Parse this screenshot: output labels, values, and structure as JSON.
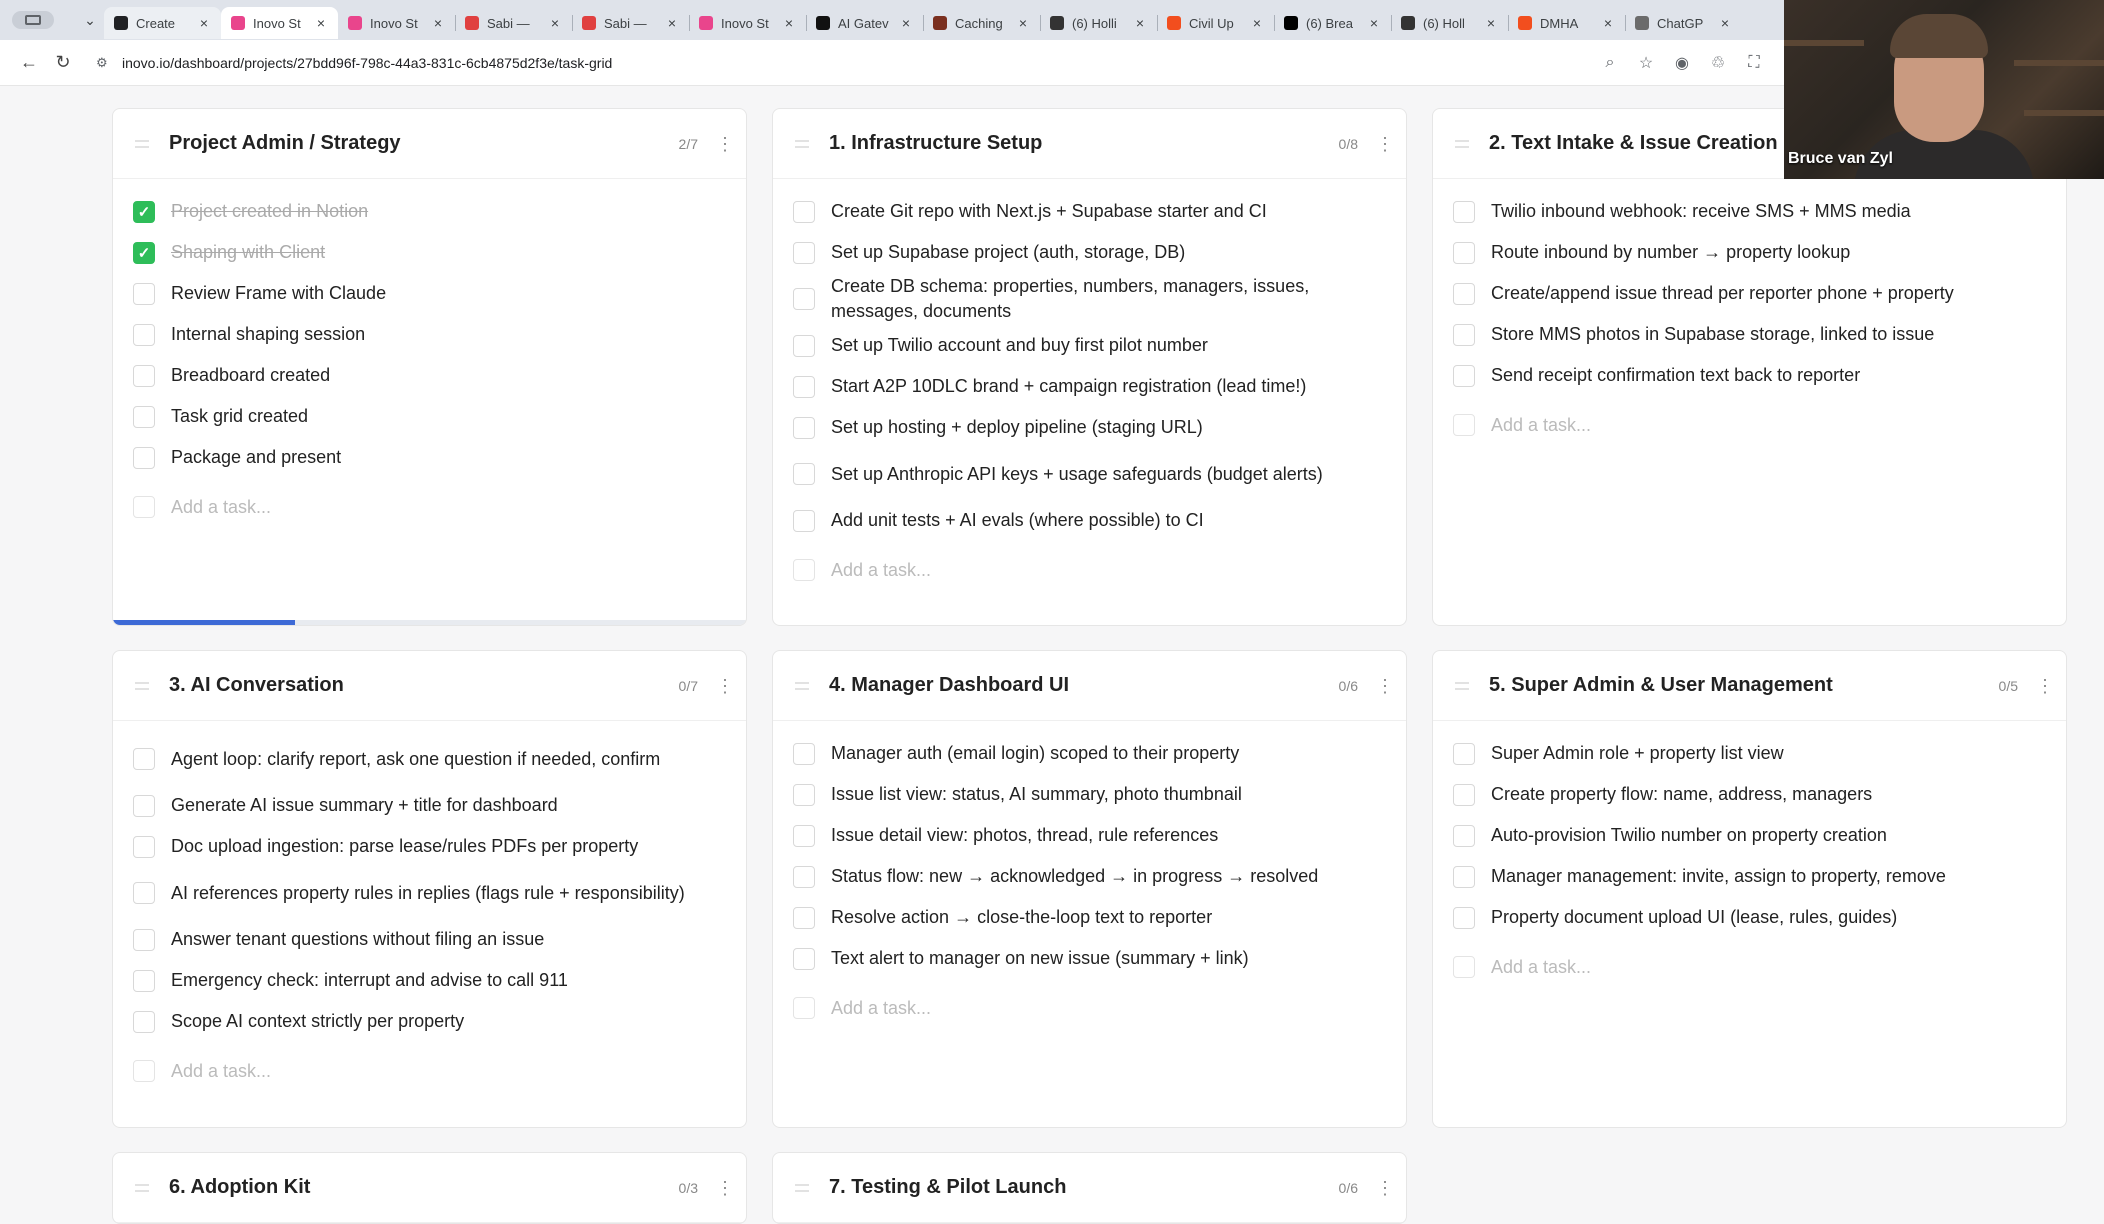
{
  "browser": {
    "tabs": [
      {
        "title": "Create",
        "favicon_color": "#202124",
        "active": false,
        "hover": true
      },
      {
        "title": "Inovo St",
        "favicon_color": "#e9458c",
        "active": true
      },
      {
        "title": "Inovo St",
        "favicon_color": "#e9458c",
        "active": false
      },
      {
        "title": "Sabi —",
        "favicon_color": "#e04040",
        "active": false
      },
      {
        "title": "Sabi —",
        "favicon_color": "#e04040",
        "active": false
      },
      {
        "title": "Inovo St",
        "favicon_color": "#e9458c",
        "active": false
      },
      {
        "title": "AI Gatev",
        "favicon_color": "#111111",
        "active": false
      },
      {
        "title": "Caching",
        "favicon_color": "#7a2f1f",
        "active": false
      },
      {
        "title": "(6) Holli",
        "favicon_color": "#333333",
        "active": false
      },
      {
        "title": "Civil Up",
        "favicon_color": "#f24e1e",
        "active": false
      },
      {
        "title": "(6) Brea",
        "favicon_color": "#000000",
        "active": false
      },
      {
        "title": "(6) Holl",
        "favicon_color": "#333333",
        "active": false
      },
      {
        "title": "DMHA",
        "favicon_color": "#f24e1e",
        "active": false
      },
      {
        "title": "ChatGP",
        "favicon_color": "#6b6b6b",
        "active": false
      }
    ],
    "url": "inovo.io/dashboard/projects/27bdd96f-798c-44a3-831c-6cb4875d2f3e/task-grid"
  },
  "add_task_placeholder": "Add a task...",
  "cards": [
    {
      "title": "Project Admin / Strategy",
      "count": "2/7",
      "progress": 0.286,
      "tasks": [
        {
          "text": "Project created in Notion",
          "done": true
        },
        {
          "text": "Shaping with Client",
          "done": true
        },
        {
          "text": "Review Frame with Claude",
          "done": false
        },
        {
          "text": "Internal shaping session",
          "done": false
        },
        {
          "text": "Breadboard created",
          "done": false
        },
        {
          "text": "Task grid created",
          "done": false
        },
        {
          "text": "Package and present",
          "done": false
        }
      ]
    },
    {
      "title": "1. Infrastructure Setup",
      "count": "0/8",
      "tasks": [
        {
          "text": "Create Git repo with Next.js + Supabase starter and CI",
          "done": false
        },
        {
          "text": "Set up Supabase project (auth, storage, DB)",
          "done": false
        },
        {
          "text": "Create DB schema: properties, numbers, managers, issues, messages, documents",
          "done": false,
          "two_line": true
        },
        {
          "text": "Set up Twilio account and buy first pilot number",
          "done": false
        },
        {
          "text": "Start A2P 10DLC brand + campaign registration (lead time!)",
          "done": false
        },
        {
          "text": "Set up hosting + deploy pipeline (staging URL)",
          "done": false
        },
        {
          "text": "Set up Anthropic API keys + usage safeguards (budget alerts)",
          "done": false,
          "two_line": true
        },
        {
          "text": "Add unit tests + AI evals (where possible) to CI",
          "done": false
        }
      ]
    },
    {
      "title": "2. Text Intake & Issue Creation",
      "count": "",
      "tasks": [
        {
          "text": "Twilio inbound webhook: receive SMS + MMS media",
          "done": false
        },
        {
          "text": "Route inbound by number → property lookup",
          "done": false
        },
        {
          "text": "Create/append issue thread per reporter phone + property",
          "done": false
        },
        {
          "text": "Store MMS photos in Supabase storage, linked to issue",
          "done": false
        },
        {
          "text": "Send receipt confirmation text back to reporter",
          "done": false
        }
      ]
    },
    {
      "title": "3. AI Conversation",
      "count": "0/7",
      "tasks": [
        {
          "text": "Agent loop: clarify report, ask one question if needed, confirm",
          "done": false,
          "two_line": true
        },
        {
          "text": "Generate AI issue summary + title for dashboard",
          "done": false
        },
        {
          "text": "Doc upload ingestion: parse lease/rules PDFs per property",
          "done": false
        },
        {
          "text": "AI references property rules in replies (flags rule + responsibility)",
          "done": false,
          "two_line": true
        },
        {
          "text": "Answer tenant questions without filing an issue",
          "done": false
        },
        {
          "text": "Emergency check: interrupt and advise to call 911",
          "done": false
        },
        {
          "text": "Scope AI context strictly per property",
          "done": false
        }
      ]
    },
    {
      "title": "4. Manager Dashboard UI",
      "count": "0/6",
      "tasks": [
        {
          "text": "Manager auth (email login) scoped to their property",
          "done": false
        },
        {
          "text": "Issue list view: status, AI summary, photo thumbnail",
          "done": false
        },
        {
          "text": "Issue detail view: photos, thread, rule references",
          "done": false
        },
        {
          "text": "Status flow: new → acknowledged → in progress → resolved",
          "done": false
        },
        {
          "text": "Resolve action → close-the-loop text to reporter",
          "done": false
        },
        {
          "text": "Text alert to manager on new issue (summary + link)",
          "done": false
        }
      ]
    },
    {
      "title": "5. Super Admin & User Management",
      "count": "0/5",
      "tasks": [
        {
          "text": "Super Admin role + property list view",
          "done": false
        },
        {
          "text": "Create property flow: name, address, managers",
          "done": false
        },
        {
          "text": "Auto-provision Twilio number on property creation",
          "done": false
        },
        {
          "text": "Manager management: invite, assign to property, remove",
          "done": false
        },
        {
          "text": "Property document upload UI (lease, rules, guides)",
          "done": false
        }
      ]
    },
    {
      "title": "6. Adoption Kit",
      "count": "0/3",
      "tasks": []
    },
    {
      "title": "7. Testing & Pilot Launch",
      "count": "0/6",
      "tasks": []
    }
  ],
  "webcam": {
    "name": "Bruce van Zyl"
  }
}
